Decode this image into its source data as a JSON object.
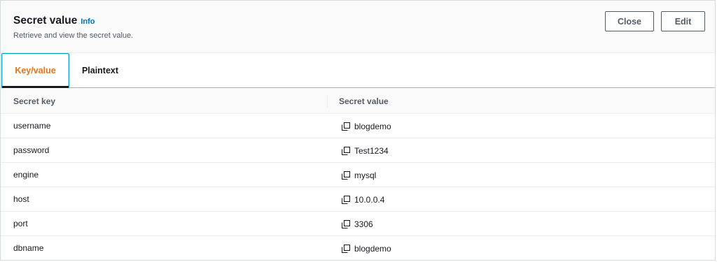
{
  "header": {
    "title": "Secret value",
    "info_link": "Info",
    "subtitle": "Retrieve and view the secret value.",
    "close_label": "Close",
    "edit_label": "Edit"
  },
  "tabs": [
    {
      "label": "Key/value",
      "active": true
    },
    {
      "label": "Plaintext",
      "active": false
    }
  ],
  "table": {
    "columns": [
      "Secret key",
      "Secret value"
    ],
    "rows": [
      {
        "key": "username",
        "value": "blogdemo"
      },
      {
        "key": "password",
        "value": "Test1234"
      },
      {
        "key": "engine",
        "value": "mysql"
      },
      {
        "key": "host",
        "value": "10.0.0.4"
      },
      {
        "key": "port",
        "value": "3306"
      },
      {
        "key": "dbname",
        "value": "blogdemo"
      }
    ]
  },
  "icons": {
    "copy": "copy-icon"
  },
  "colors": {
    "accent_orange": "#ec7211",
    "link_blue": "#0073bb",
    "focus_ring": "#00a1c9"
  }
}
